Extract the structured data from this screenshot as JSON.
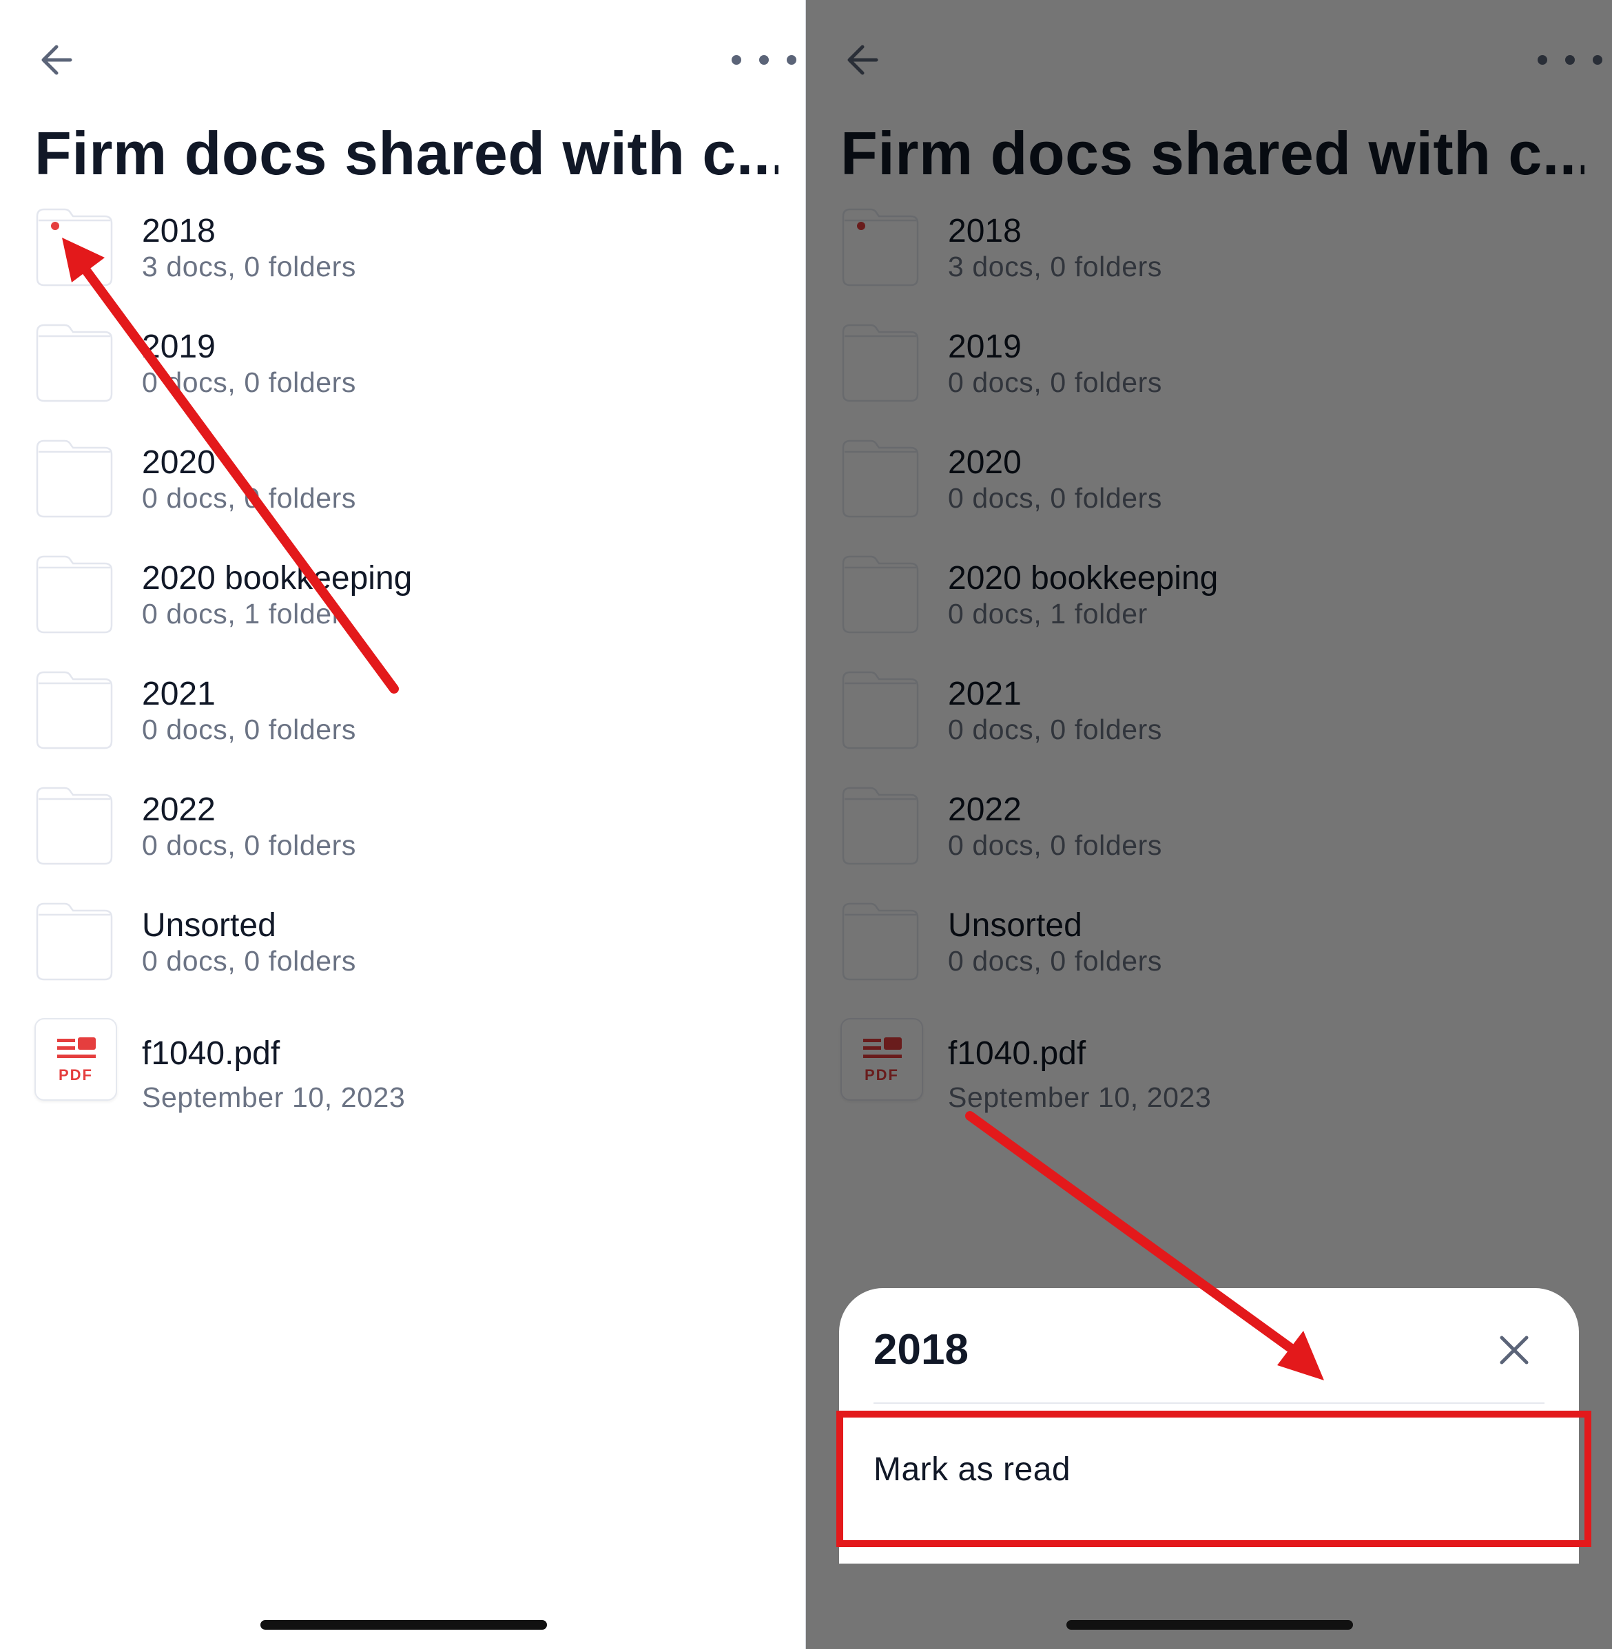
{
  "header": {
    "back_icon": "arrow-left-icon",
    "more_icon": "more-horizontal-icon",
    "title": "Firm docs shared with c..."
  },
  "colors": {
    "unread_dot": "#e53e3e",
    "pdf_accent": "#e53e3e",
    "annotation_red": "#e3191b",
    "subtext": "#6b7384"
  },
  "items": [
    {
      "name": "2018",
      "meta": "3 docs, 0 folders",
      "type": "folder",
      "unread": true
    },
    {
      "name": "2019",
      "meta": "0 docs, 0 folders",
      "type": "folder",
      "unread": false
    },
    {
      "name": "2020",
      "meta": "0 docs, 0 folders",
      "type": "folder",
      "unread": false
    },
    {
      "name": "2020 bookkeeping",
      "meta": "0 docs, 1 folder",
      "type": "folder",
      "unread": false
    },
    {
      "name": "2021",
      "meta": "0 docs, 0 folders",
      "type": "folder",
      "unread": false
    },
    {
      "name": "2022",
      "meta": "0 docs, 0 folders",
      "type": "folder",
      "unread": false
    },
    {
      "name": "Unsorted",
      "meta": "0 docs, 0 folders",
      "type": "folder",
      "unread": false
    },
    {
      "name": "f1040.pdf",
      "meta": "September 10, 2023",
      "type": "pdf",
      "badge": "PDF"
    }
  ],
  "action_sheet": {
    "title": "2018",
    "close_icon": "close-icon",
    "options": [
      "Mark as read"
    ]
  }
}
